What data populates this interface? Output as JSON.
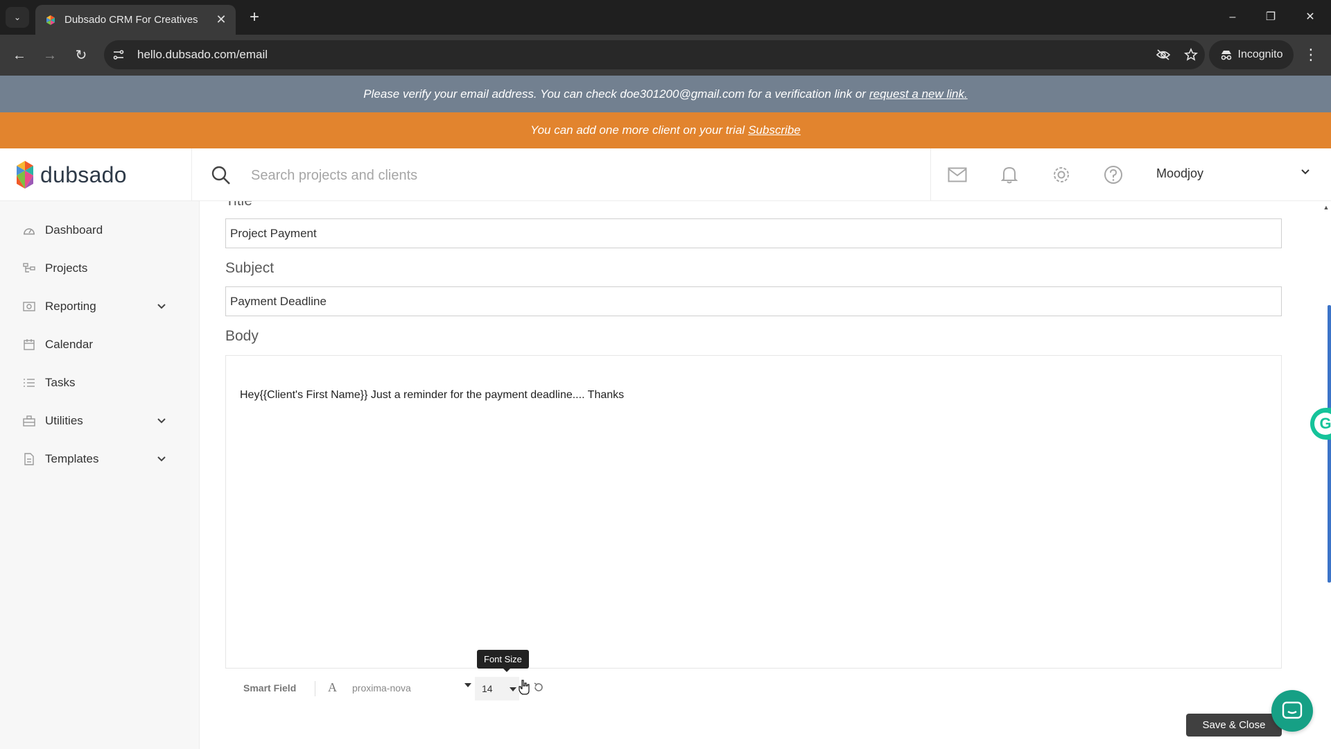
{
  "browser": {
    "tab_title": "Dubsado CRM For Creatives",
    "url": "hello.dubsado.com/email",
    "incognito_label": "Incognito"
  },
  "banners": {
    "verify_text": "Please verify your email address. You can check doe301200@gmail.com for a verification link or",
    "verify_link": "request a new link.",
    "trial_text": "You can add one more client on your trial",
    "trial_link": "Subscribe"
  },
  "header": {
    "logo_text": "dubsado",
    "search_placeholder": "Search projects and clients",
    "user_name": "Moodjoy"
  },
  "sidebar": {
    "items": [
      {
        "label": "Dashboard",
        "icon": "dashboard-icon"
      },
      {
        "label": "Projects",
        "icon": "projects-icon"
      },
      {
        "label": "Reporting",
        "icon": "reporting-icon",
        "expandable": true
      },
      {
        "label": "Calendar",
        "icon": "calendar-icon"
      },
      {
        "label": "Tasks",
        "icon": "tasks-icon"
      },
      {
        "label": "Utilities",
        "icon": "utilities-icon",
        "expandable": true
      },
      {
        "label": "Templates",
        "icon": "templates-icon",
        "expandable": true
      }
    ]
  },
  "form": {
    "title_label": "Title",
    "title_value": "Project Payment",
    "subject_label": "Subject",
    "subject_value": "Payment Deadline",
    "body_label": "Body",
    "body_text": "Hey{{Client's First Name}} Just a reminder for the payment deadline.... Thanks"
  },
  "toolbar": {
    "smart_field": "Smart Field",
    "font_family": "proxima-nova",
    "font_size": "14",
    "tooltip": "Font Size"
  },
  "actions": {
    "save_close": "Save & Close"
  },
  "colors": {
    "verify_banner": "#728090",
    "trial_banner": "#e2842e",
    "scroll_thumb": "#3c74c8"
  }
}
